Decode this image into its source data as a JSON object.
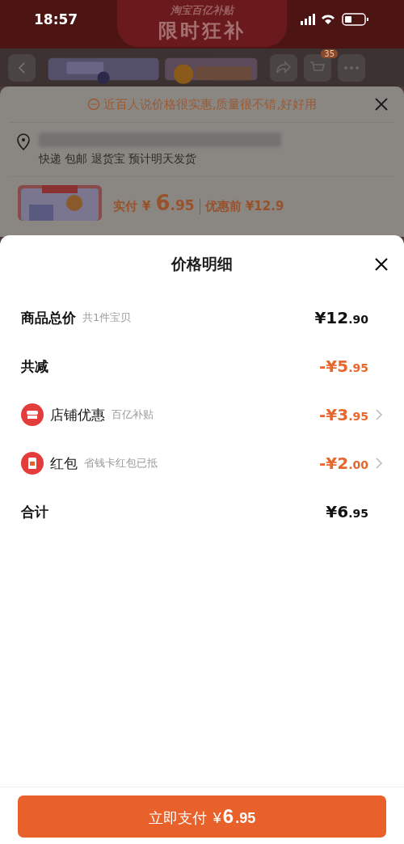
{
  "status_bar": {
    "time": "18:57"
  },
  "background_page": {
    "banner": {
      "subtitle": "淘宝百亿补贴",
      "title": "限时狂补"
    },
    "cart_badge": "35",
    "tip": "近百人说价格很实惠,质量很不错,好好用",
    "shipping": "快递 包邮 退货宝 预计明天发货",
    "price": {
      "label": "实付",
      "currency": "¥",
      "integer": "6",
      "fraction": ".95",
      "original": "优惠前 ¥12.9"
    }
  },
  "price_sheet": {
    "title": "价格明细",
    "rows": [
      {
        "kind": "total",
        "label": "商品总价",
        "note": "共1件宝贝",
        "discount": false,
        "integer": "¥12",
        "fraction": ".90"
      },
      {
        "kind": "total",
        "label": "共减",
        "discount": true,
        "integer": "-¥5",
        "fraction": ".95"
      },
      {
        "kind": "store",
        "label": "店铺优惠",
        "note": "百亿补贴",
        "discount": true,
        "integer": "-¥3",
        "fraction": ".95"
      },
      {
        "kind": "packet",
        "label": "红包",
        "note": "省钱卡红包已抵",
        "discount": true,
        "integer": "-¥2",
        "fraction": ".00"
      },
      {
        "kind": "total",
        "label": "合计",
        "discount": false,
        "integer": "¥6",
        "fraction": ".95"
      }
    ],
    "pay_button": {
      "label": "立即支付",
      "currency": "¥",
      "integer": "6",
      "fraction": ".95"
    }
  }
}
